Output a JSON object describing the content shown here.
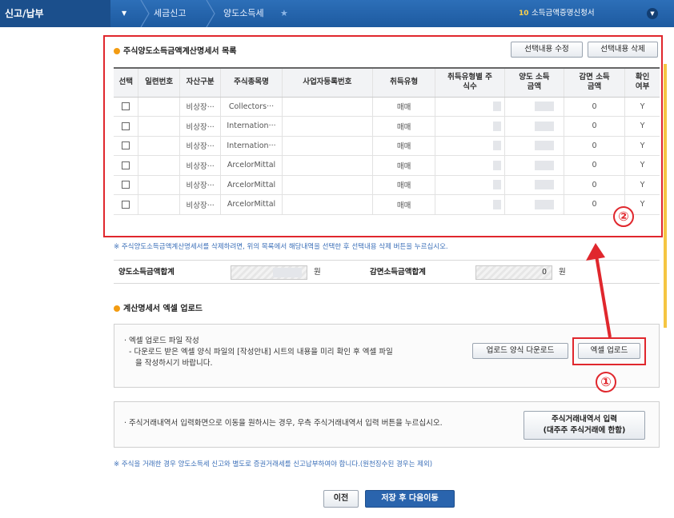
{
  "nav": {
    "home": "신고/납부",
    "crumbs": [
      "세금신고",
      "양도소득세"
    ],
    "right_num": "10",
    "right_label": "소득금액증명신청서"
  },
  "list_section": {
    "title": "주식양도소득금액계산명세서 목록",
    "edit_button": "선택내용 수정",
    "delete_button": "선택내용 삭제",
    "columns": [
      "선택",
      "일련번호",
      "자산구분",
      "주식종목명",
      "사업자등록번호",
      "취득유형",
      "취득유형별 주식수",
      "양도 소득금액",
      "감면 소득금액",
      "확인 여부"
    ],
    "rows": [
      {
        "asset": "비상장···",
        "name": "Collectors···",
        "type": "매매",
        "reduce": "0",
        "confirm": "Y"
      },
      {
        "asset": "비상장···",
        "name": "Internation···",
        "type": "매매",
        "reduce": "0",
        "confirm": "Y"
      },
      {
        "asset": "비상장···",
        "name": "Internation···",
        "type": "매매",
        "reduce": "0",
        "confirm": "Y"
      },
      {
        "asset": "비상장···",
        "name": "ArcelorMittal",
        "type": "매매",
        "reduce": "0",
        "confirm": "Y"
      },
      {
        "asset": "비상장···",
        "name": "ArcelorMittal",
        "type": "매매",
        "reduce": "0",
        "confirm": "Y"
      },
      {
        "asset": "비상장···",
        "name": "ArcelorMittal",
        "type": "매매",
        "reduce": "0",
        "confirm": "Y"
      }
    ],
    "note": "※ 주식양도소득금액계산명세서를 삭제하려면, 위의 목록에서 해당내역을 선택한 후 선택내용 삭제 버튼을 누르십시오."
  },
  "summary": {
    "transfer_label": "양도소득금액합계",
    "transfer_unit": "원",
    "reduce_label": "감면소득금액합계",
    "reduce_value": "0",
    "reduce_unit": "원"
  },
  "upload_section": {
    "title": "계산명세서 엑셀 업로드",
    "line1": "· 엑셀 업로드 파일 작성",
    "line2": "- 다운로드 받은 엑셀 양식 파일의 [작성안내] 시트의 내용을 미리 확인 후 엑셀 파일",
    "line3": "을 작성하시기 바랍니다.",
    "download_button": "업로드 양식 다운로드",
    "upload_button": "엑셀 업로드"
  },
  "trade_section": {
    "text": "· 주식거래내역서 입력화면으로 이동을 원하시는 경우, 우측 주식거래내역서 입력 버튼을 누르십시오.",
    "button_line1": "주식거래내역서 입력",
    "button_line2": "(대주주 주식거래에 한함)"
  },
  "footer_note": "※ 주식을 거래한 경우 양도소득세 신고와 별도로 증권거래세를 신고납부하여야 합니다.(원천징수된 경우는 제외)",
  "buttons": {
    "prev": "이전",
    "save_next": "저장 후 다음이동"
  },
  "annotations": {
    "circle1": "①",
    "circle2": "②"
  },
  "colors": {
    "nav_bg": "#1d5aa0",
    "annotation_red": "#e0272d",
    "primary_button": "#2a64ad",
    "section_dot": "#f39c12"
  }
}
